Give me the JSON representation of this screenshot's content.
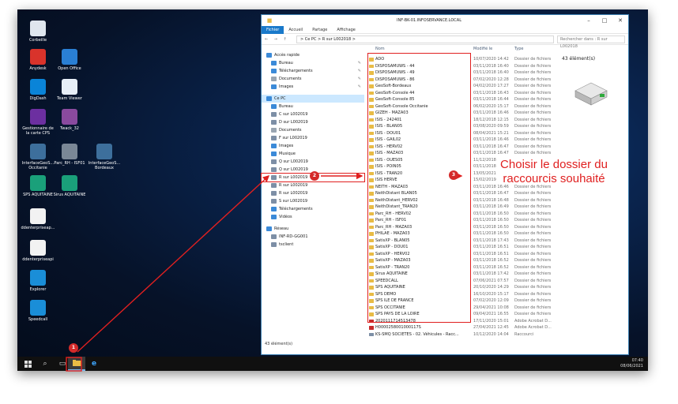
{
  "desktop_icons": [
    {
      "label": "Corbeille",
      "name": "recycle-bin-icon",
      "color": "#dfe6ee"
    },
    {
      "label": "Anydesk",
      "name": "anydesk-icon",
      "color": "#d9332b"
    },
    {
      "label": "Open Office",
      "name": "open-office-icon",
      "color": "#2a7fd4"
    },
    {
      "label": "DigDash",
      "name": "digdash-icon",
      "color": "#0a84d8"
    },
    {
      "label": "Team Viewer",
      "name": "teamviewer-icon",
      "color": "#e7eef7"
    },
    {
      "label": "Gestionnaire de la carte CPS",
      "name": "cps-manager-icon",
      "color": "#6c2fa0"
    },
    {
      "label": "Twack_32",
      "name": "twack-icon",
      "color": "#8a4a9e"
    },
    {
      "label": "InterfaceGeoS... Occitanie",
      "name": "geosoft-occitanie-icon",
      "color": "#3d6f9c"
    },
    {
      "label": "Parc_RH - ISF01",
      "name": "parc-rh-icon",
      "color": "#7a8796"
    },
    {
      "label": "InterfaceGeoS... Bordeaux",
      "name": "geosoft-bordeaux-icon",
      "color": "#3d6f9c"
    },
    {
      "label": "SPS AQUITAINE",
      "name": "sps-aquitaine-icon",
      "color": "#1aa07a"
    },
    {
      "label": "Sirus AQUITAINE",
      "name": "sirus-aquitaine-icon",
      "color": "#1aa07a"
    },
    {
      "label": "ddenterpriseap...",
      "name": "document-icon",
      "color": "#f2f2f2"
    },
    {
      "label": "ddenterpriseapi",
      "name": "document-icon-2",
      "color": "#f2f2f2"
    },
    {
      "label": "Explorer",
      "name": "explorer-icon",
      "color": "#1a8ed8"
    },
    {
      "label": "Speedcall",
      "name": "speedcall-icon",
      "color": "#1a8ed8"
    }
  ],
  "window": {
    "title": "INF-BK-01.INFOSERVANCE.LOCAL",
    "ribbon_tabs": [
      "Fichier",
      "Accueil",
      "Partage",
      "Affichage"
    ],
    "path": "> Ce PC  >  R sur L002018  >",
    "search_placeholder": "Rechercher dans : R sur L002018",
    "status": "43 élément(s)",
    "preview_count": "43 élément(s)"
  },
  "nav": [
    {
      "label": "Accès rapide",
      "color": "#3b8ad8"
    },
    {
      "label": "Bureau",
      "color": "#3b8ad8",
      "pin": true
    },
    {
      "label": "Téléchargements",
      "color": "#3b8ad8",
      "pin": true
    },
    {
      "label": "Documents",
      "color": "#9aa6b2",
      "pin": true
    },
    {
      "label": "Images",
      "color": "#3b8ad8",
      "pin": true
    },
    {
      "label": "Ce PC",
      "color": "#3b8ad8",
      "sel": true
    },
    {
      "label": "Bureau",
      "color": "#3b8ad8"
    },
    {
      "label": "C sur L002019",
      "color": "#7d8fa6"
    },
    {
      "label": "D sur L002019",
      "color": "#7d8fa6"
    },
    {
      "label": "Documents",
      "color": "#9aa6b2"
    },
    {
      "label": "F sur L002019",
      "color": "#7d8fa6"
    },
    {
      "label": "Images",
      "color": "#3b8ad8"
    },
    {
      "label": "Musique",
      "color": "#3b8ad8"
    },
    {
      "label": "Q sur L002019",
      "color": "#7d8fa6"
    },
    {
      "label": "Q sur L002019",
      "color": "#7d8fa6"
    },
    {
      "label": "R sur L002019",
      "color": "#7d8fa6",
      "hl": true
    },
    {
      "label": "R sur L002019",
      "color": "#7d8fa6"
    },
    {
      "label": "R sur L002019",
      "color": "#7d8fa6"
    },
    {
      "label": "S sur L002019",
      "color": "#7d8fa6"
    },
    {
      "label": "Téléchargements",
      "color": "#3b8ad8"
    },
    {
      "label": "Vidéos",
      "color": "#3b8ad8"
    },
    {
      "label": "Réseau",
      "color": "#3b8ad8"
    },
    {
      "label": "INF-RD-GG001",
      "color": "#7d8fa6"
    },
    {
      "label": "tsclient",
      "color": "#7d8fa6"
    }
  ],
  "columns": {
    "name": "Nom",
    "date": "Modifié le",
    "type": "Type"
  },
  "files": [
    {
      "n": "ADO",
      "d": "10/07/2020 14:42",
      "t": "Dossier de fichiers",
      "k": "folder"
    },
    {
      "n": "DISPOSAMUWS - 44",
      "d": "03/11/2018 16:40",
      "t": "Dossier de fichiers",
      "k": "folder"
    },
    {
      "n": "DISPOSAMUWS - 49",
      "d": "03/11/2018 16:40",
      "t": "Dossier de fichiers",
      "k": "folder"
    },
    {
      "n": "DISPOSAMUWS - 86",
      "d": "07/02/2020 12:28",
      "t": "Dossier de fichiers",
      "k": "folder"
    },
    {
      "n": "GeoSoft-Bordeaux",
      "d": "04/02/2020 17:27",
      "t": "Dossier de fichiers",
      "k": "folder"
    },
    {
      "n": "GeoSoft-Console 44",
      "d": "03/11/2018 16:43",
      "t": "Dossier de fichiers",
      "k": "folder"
    },
    {
      "n": "GeoSoft-Console 85",
      "d": "03/11/2018 16:44",
      "t": "Dossier de fichiers",
      "k": "folder"
    },
    {
      "n": "GeoSoft-Console Occitanie",
      "d": "06/02/2020 15:17",
      "t": "Dossier de fichiers",
      "k": "folder"
    },
    {
      "n": "GIZEH - MAZA03",
      "d": "03/11/2018 16:46",
      "t": "Dossier de fichiers",
      "k": "folder"
    },
    {
      "n": "ISIS - 242401",
      "d": "18/12/2018 12:15",
      "t": "Dossier de fichiers",
      "k": "folder"
    },
    {
      "n": "ISIS - BLAN05",
      "d": "03/08/2020 09:59",
      "t": "Dossier de fichiers",
      "k": "folder"
    },
    {
      "n": "ISIS - DOU01",
      "d": "08/04/2021 15:21",
      "t": "Dossier de fichiers",
      "k": "folder"
    },
    {
      "n": "ISIS - GAIL02",
      "d": "03/11/2018 16:46",
      "t": "Dossier de fichiers",
      "k": "folder"
    },
    {
      "n": "ISIS - HERV02",
      "d": "03/11/2018 16:47",
      "t": "Dossier de fichiers",
      "k": "folder"
    },
    {
      "n": "ISIS - MAZA03",
      "d": "03/11/2018 16:47",
      "t": "Dossier de fichiers",
      "k": "folder"
    },
    {
      "n": "ISIS - OUES05",
      "d": "11/12/2018",
      "t": "",
      "k": "folder"
    },
    {
      "n": "ISIS - POIN05",
      "d": "03/11/2018",
      "t": "",
      "k": "folder"
    },
    {
      "n": "ISIS - TRAN20",
      "d": "13/05/2021",
      "t": "",
      "k": "folder"
    },
    {
      "n": "ISIS HERVE",
      "d": "15/02/2019",
      "t": "",
      "k": "folder"
    },
    {
      "n": "NEITH - MAZA03",
      "d": "03/11/2018 16:46",
      "t": "Dossier de fichiers",
      "k": "folder"
    },
    {
      "n": "NeithDistant BLAN05",
      "d": "03/11/2018 16:47",
      "t": "Dossier de fichiers",
      "k": "folder"
    },
    {
      "n": "NeithDistant_HERV02",
      "d": "03/11/2018 16:48",
      "t": "Dossier de fichiers",
      "k": "folder"
    },
    {
      "n": "NeithDistant_TRAN20",
      "d": "03/11/2018 16:49",
      "t": "Dossier de fichiers",
      "k": "folder"
    },
    {
      "n": "Parc_RH - HERV02",
      "d": "03/11/2018 16:50",
      "t": "Dossier de fichiers",
      "k": "folder"
    },
    {
      "n": "Parc_RH - ISF01",
      "d": "03/11/2018 16:50",
      "t": "Dossier de fichiers",
      "k": "folder"
    },
    {
      "n": "Parc_RH - MAZA03",
      "d": "03/11/2018 16:50",
      "t": "Dossier de fichiers",
      "k": "folder"
    },
    {
      "n": "PHILAE - MAZA03",
      "d": "03/11/2018 16:50",
      "t": "Dossier de fichiers",
      "k": "folder"
    },
    {
      "n": "SatisXP - BLAN05",
      "d": "03/11/2018 17:43",
      "t": "Dossier de fichiers",
      "k": "folder"
    },
    {
      "n": "SatisXP - DOU01",
      "d": "03/11/2018 16:51",
      "t": "Dossier de fichiers",
      "k": "folder"
    },
    {
      "n": "SatisXP - HERV02",
      "d": "03/11/2018 16:51",
      "t": "Dossier de fichiers",
      "k": "folder"
    },
    {
      "n": "SatisXP - MAZA03",
      "d": "03/11/2018 16:52",
      "t": "Dossier de fichiers",
      "k": "folder"
    },
    {
      "n": "SatisXP - TRAN20",
      "d": "03/11/2018 16:52",
      "t": "Dossier de fichiers",
      "k": "folder"
    },
    {
      "n": "Sirus AQUITAINE",
      "d": "03/11/2018 17:42",
      "t": "Dossier de fichiers",
      "k": "folder"
    },
    {
      "n": "SPEEDCALL",
      "d": "07/06/2021 07:57",
      "t": "Dossier de fichiers",
      "k": "folder"
    },
    {
      "n": "SPS AQUITAINE",
      "d": "20/10/2020 14:29",
      "t": "Dossier de fichiers",
      "k": "folder"
    },
    {
      "n": "SPS DEMO",
      "d": "16/10/2020 15:17",
      "t": "Dossier de fichiers",
      "k": "folder"
    },
    {
      "n": "SPS ILE DE FRANCE",
      "d": "07/02/2020 12:09",
      "t": "Dossier de fichiers",
      "k": "folder"
    },
    {
      "n": "SPS OCCITANIE",
      "d": "29/04/2021 10:08",
      "t": "Dossier de fichiers",
      "k": "folder"
    },
    {
      "n": "SPS PAYS DE LA LOIRE",
      "d": "09/04/2021 16:55",
      "t": "Dossier de fichiers",
      "k": "folder"
    },
    {
      "n": "2020111714513478",
      "d": "17/11/2020 15:01",
      "t": "Adobe Acrobat D...",
      "k": "pdf"
    },
    {
      "n": "H0000258001000117S",
      "d": "27/04/2021 12:45",
      "t": "Adobe Acrobat D...",
      "k": "pdf"
    },
    {
      "n": "KS-SMQ SOCIETES - 02. Véhicules - Racc...",
      "d": "10/12/2020 14:04",
      "t": "Raccourci",
      "k": "lnk"
    }
  ],
  "annotations": {
    "badge1": "1",
    "badge2": "2",
    "badge3": "3",
    "callout_line1": "Choisir le dossier du",
    "callout_line2": "raccourcis souhaité"
  },
  "clock": {
    "time": "07:40",
    "date": "08/06/2021"
  },
  "accent_color": "#e02020"
}
